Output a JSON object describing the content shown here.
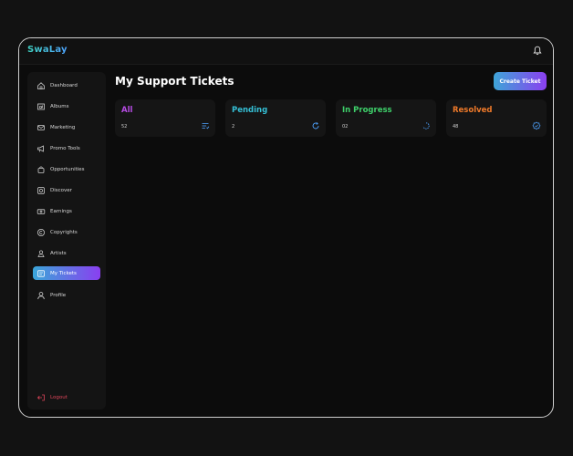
{
  "app": {
    "logo": "SwaLay"
  },
  "sidebar": {
    "items": [
      {
        "label": "Dashboard",
        "icon": "home-icon"
      },
      {
        "label": "Albums",
        "icon": "album-icon"
      },
      {
        "label": "Marketing",
        "icon": "mail-icon"
      },
      {
        "label": "Promo Tools",
        "icon": "megaphone-icon"
      },
      {
        "label": "Opportunities",
        "icon": "bag-icon"
      },
      {
        "label": "Discover",
        "icon": "compass-icon"
      },
      {
        "label": "Earnings",
        "icon": "money-icon"
      },
      {
        "label": "Copyrights",
        "icon": "copyright-icon"
      },
      {
        "label": "Artists",
        "icon": "user-group-icon"
      },
      {
        "label": "My Tickets",
        "icon": "ticket-icon",
        "active": true
      },
      {
        "label": "Profile",
        "icon": "user-icon"
      }
    ],
    "logout": {
      "label": "Logout",
      "icon": "logout-icon"
    }
  },
  "header": {
    "title": "My Support Tickets",
    "create_label": "Create Ticket"
  },
  "cards": [
    {
      "title": "All",
      "count": "52",
      "color": "#b84ce6",
      "icon": "list-icon"
    },
    {
      "title": "Pending",
      "count": "2",
      "color": "#35c0d6",
      "icon": "refresh-icon"
    },
    {
      "title": "In Progress",
      "count": "02",
      "color": "#3ed06a",
      "icon": "spinner-icon"
    },
    {
      "title": "Resolved",
      "count": "48",
      "color": "#ef7a2a",
      "icon": "check-badge-icon"
    }
  ],
  "colors": {
    "accent_start": "#3ea5d8",
    "accent_end": "#8b3ff0",
    "logout": "#e0455a"
  }
}
